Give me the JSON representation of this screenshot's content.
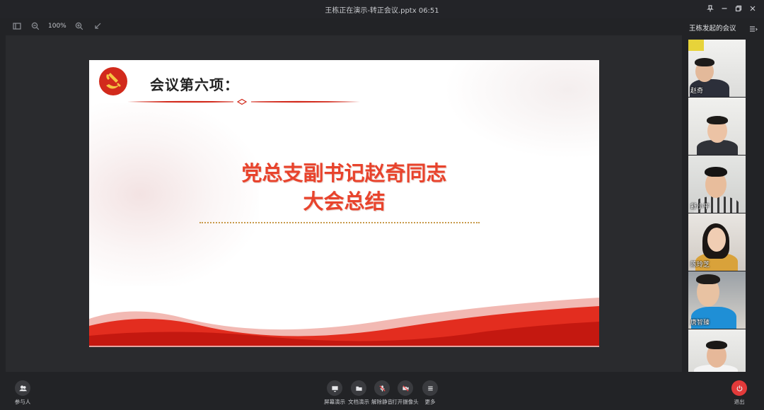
{
  "window": {
    "title": "王栋正在演示-转正会议.pptx 06:51"
  },
  "toolbar": {
    "zoom": "100%"
  },
  "slide": {
    "heading": "会议第六项：",
    "main_line1": "党总支副书记赵奇同志",
    "main_line2": "大会总结"
  },
  "sidebar": {
    "title": "王栋发起的会议",
    "participants": [
      {
        "name": "赵奇"
      },
      {
        "name": ""
      },
      {
        "name": "舒小平"
      },
      {
        "name": "陈玲芝"
      },
      {
        "name": "唐智臻"
      },
      {
        "name": ""
      }
    ]
  },
  "controls": {
    "participants": "参与人",
    "screen_share": "屏幕演示",
    "doc_share": "文档演示",
    "unmute": "解除静音",
    "camera": "打开摄像头",
    "more": "更多",
    "exit": "退出"
  },
  "colors": {
    "accent_red": "#e8432c",
    "exit_red": "#e23a3a",
    "background": "#222326"
  }
}
